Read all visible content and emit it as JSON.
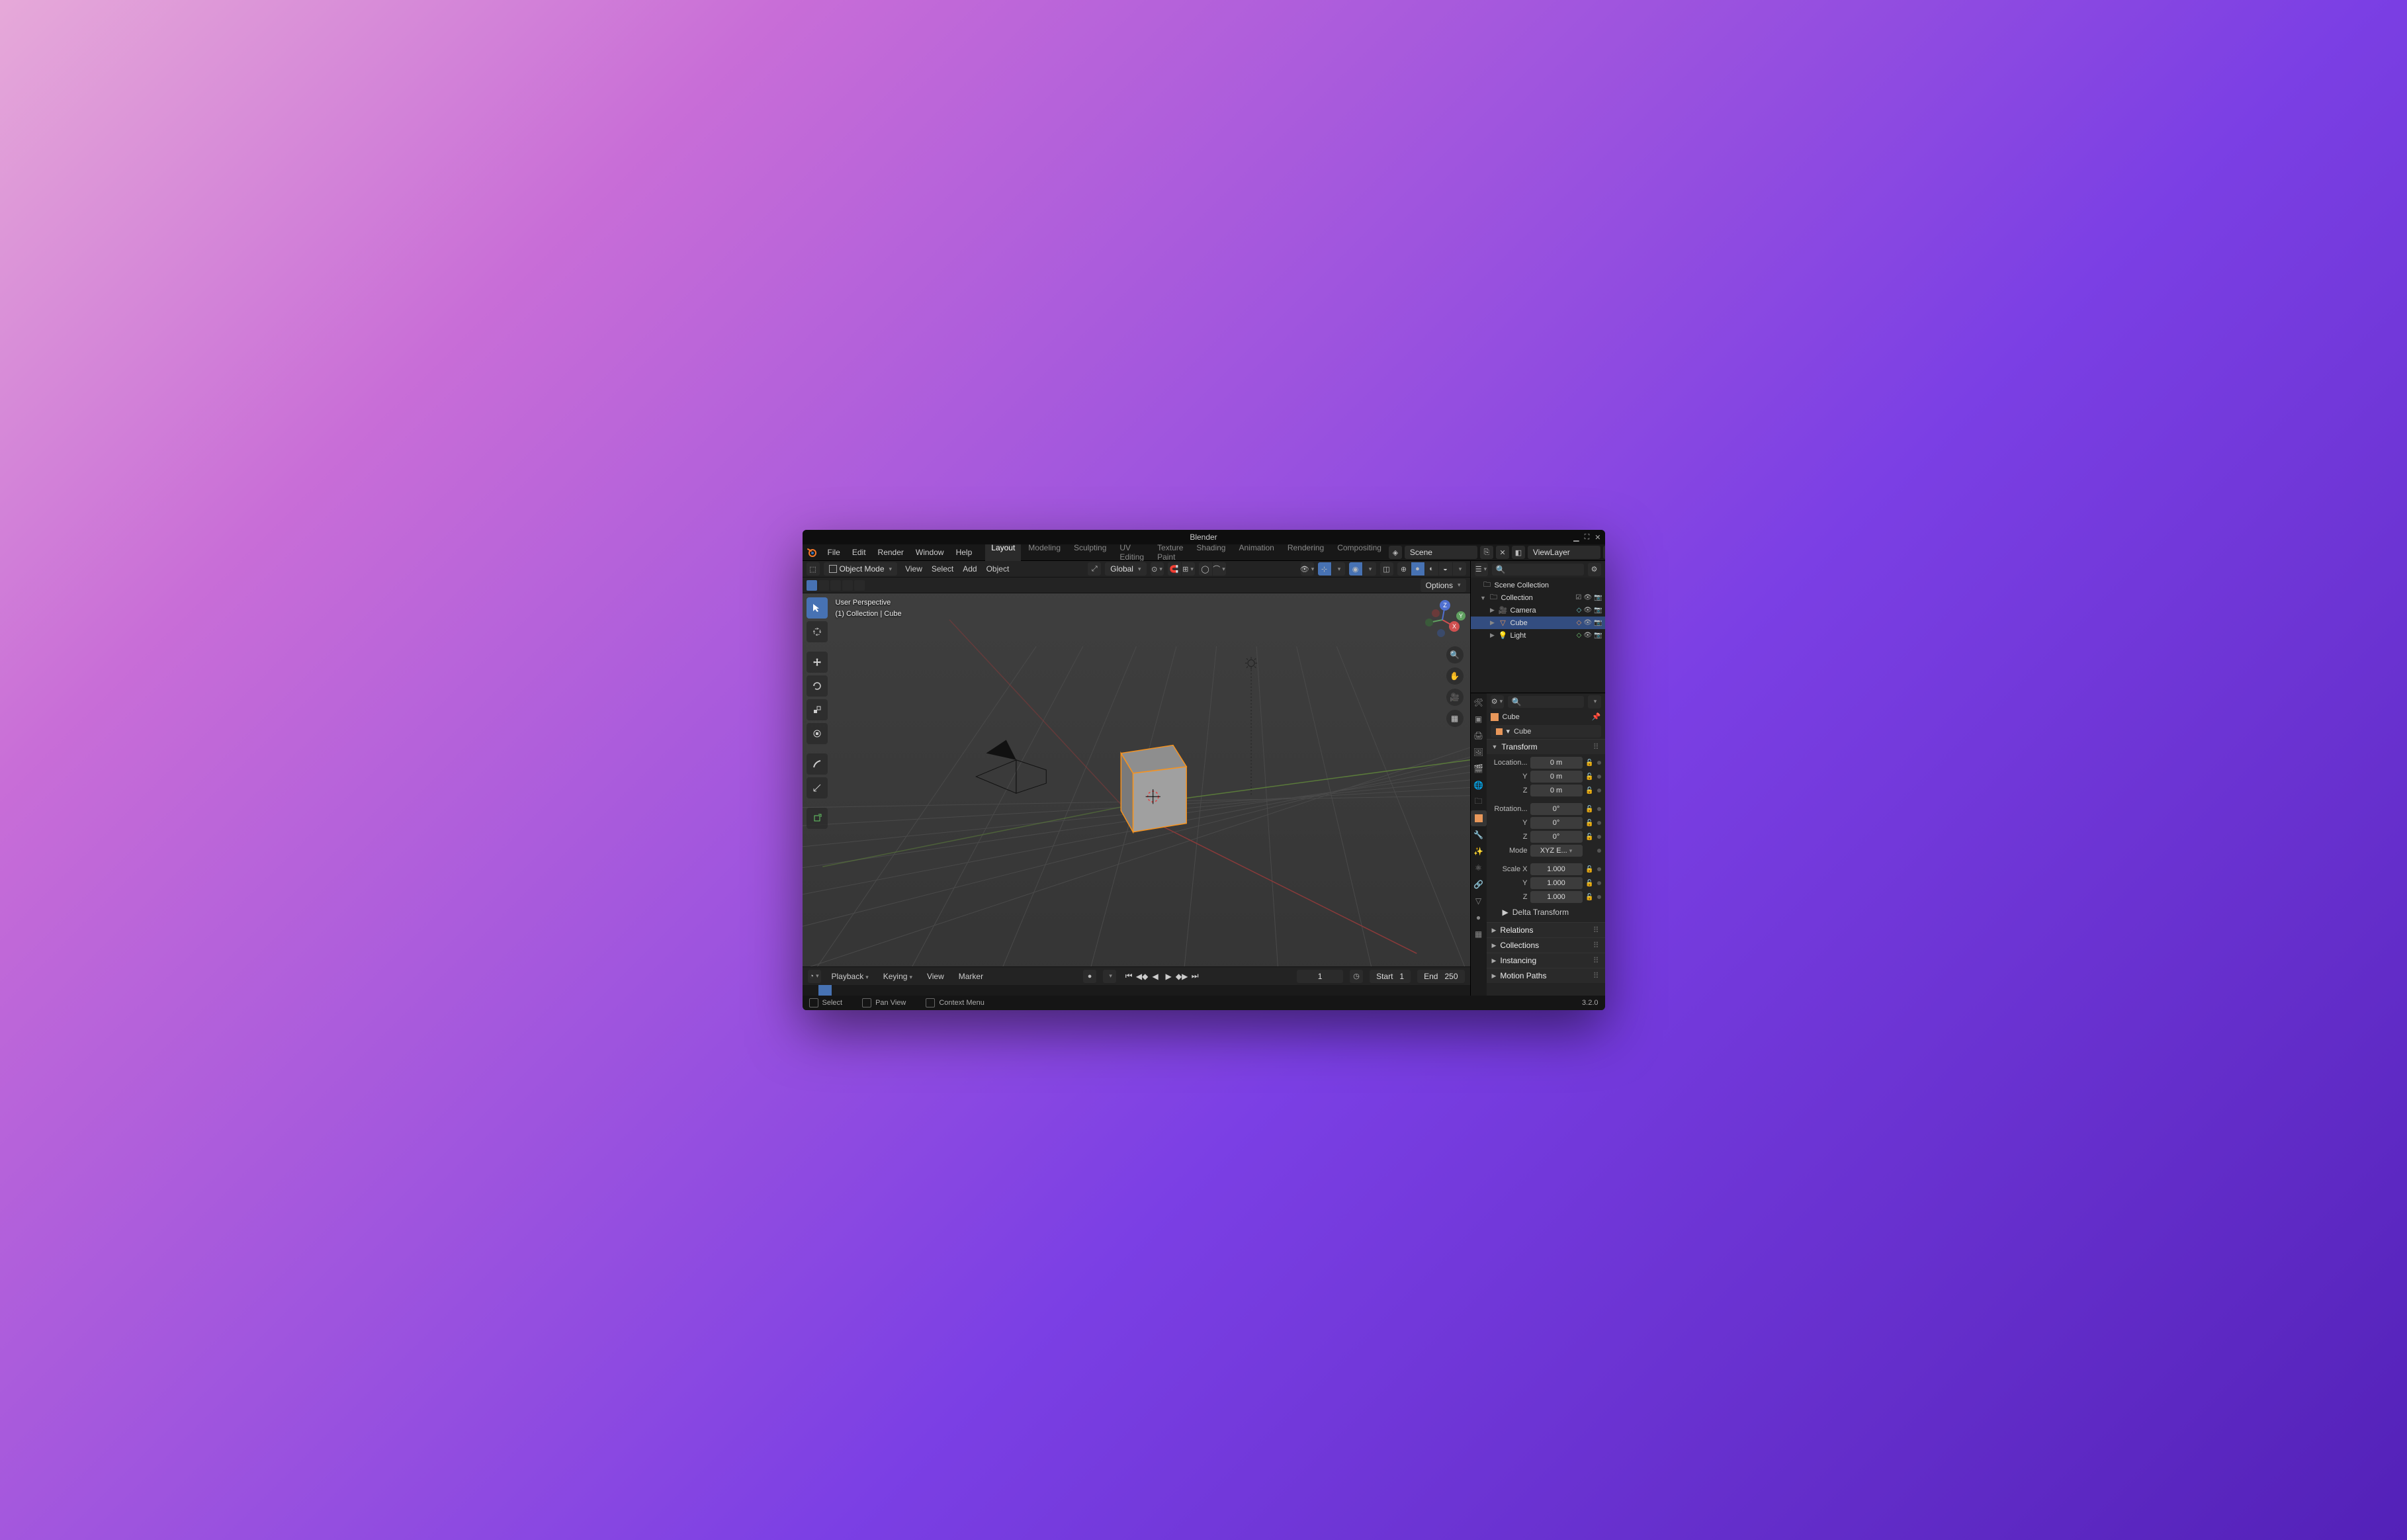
{
  "window": {
    "title": "Blender"
  },
  "menus": [
    "File",
    "Edit",
    "Render",
    "Window",
    "Help"
  ],
  "workspaces": {
    "items": [
      "Layout",
      "Modeling",
      "Sculpting",
      "UV Editing",
      "Texture Paint",
      "Shading",
      "Animation",
      "Rendering",
      "Compositing"
    ],
    "active": "Layout"
  },
  "scene": {
    "label": "Scene",
    "viewlayer": "ViewLayer"
  },
  "viewport_header": {
    "mode": "Object Mode",
    "menus": [
      "View",
      "Select",
      "Add",
      "Object"
    ],
    "orientation": "Global",
    "options_label": "Options"
  },
  "viewport_info": {
    "line1": "User Perspective",
    "line2": "(1) Collection | Cube"
  },
  "gizmo_axes": {
    "x": "X",
    "y": "Y",
    "z": "Z"
  },
  "timeline": {
    "menus": [
      "Playback",
      "Keying",
      "View",
      "Marker"
    ],
    "current": "1",
    "start_label": "Start",
    "start": "1",
    "end_label": "End",
    "end": "250"
  },
  "statusbar": {
    "select": "Select",
    "pan": "Pan View",
    "context": "Context Menu",
    "version": "3.2.0"
  },
  "outliner": {
    "root": "Scene Collection",
    "collection": "Collection",
    "items": [
      {
        "name": "Camera",
        "icon": "camera",
        "color": "#7cc"
      },
      {
        "name": "Cube",
        "icon": "mesh",
        "color": "#e8975a",
        "selected": true
      },
      {
        "name": "Light",
        "icon": "light",
        "color": "#7c7"
      }
    ]
  },
  "properties": {
    "object_name": "Cube",
    "panels": {
      "transform": {
        "title": "Transform",
        "loc_label": "Location...",
        "loc": {
          "x": "0 m",
          "y": "0 m",
          "z": "0 m"
        },
        "rot_label": "Rotation...",
        "rot": {
          "x": "0°",
          "y": "0°",
          "z": "0°"
        },
        "mode_label": "Mode",
        "mode": "XYZ E...",
        "scale_label": "Scale X",
        "scale": {
          "x": "1.000",
          "y": "1.000",
          "z": "1.000"
        },
        "delta": "Delta Transform"
      },
      "others": [
        "Relations",
        "Collections",
        "Instancing",
        "Motion Paths"
      ]
    },
    "axis": {
      "y": "Y",
      "z": "Z"
    }
  }
}
